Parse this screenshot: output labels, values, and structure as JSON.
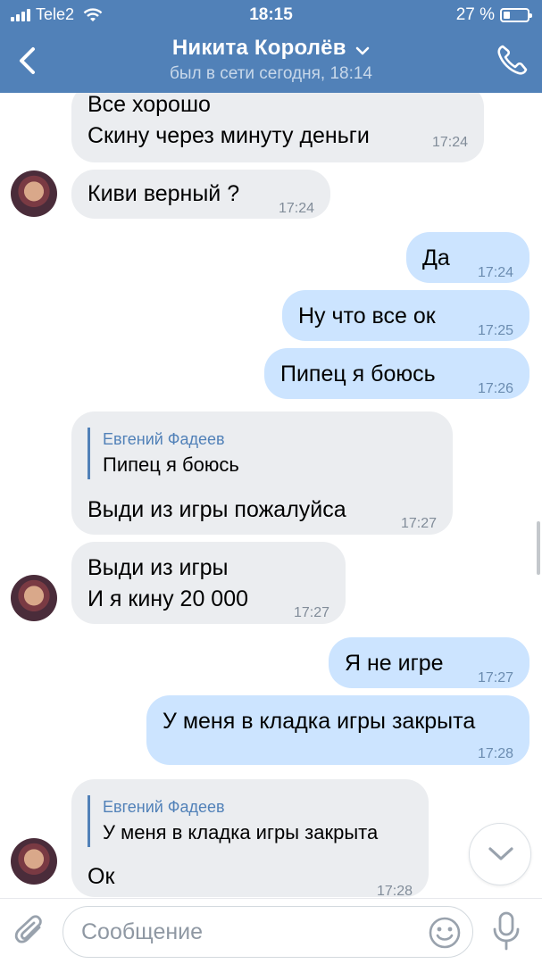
{
  "status_bar": {
    "carrier": "Tele2",
    "time": "18:15",
    "battery_percent": "27 %",
    "battery_level": 0.27
  },
  "header": {
    "contact_name": "Никита Королёв",
    "last_seen": "был в сети сегодня, 18:14"
  },
  "messages": [
    {
      "direction": "in",
      "lines": [
        "Все хорошо",
        "Скину через минуту деньги"
      ],
      "time": "17:24"
    },
    {
      "direction": "in",
      "lines": [
        "Киви верный ?"
      ],
      "time": "17:24"
    },
    {
      "direction": "out",
      "lines": [
        "Да"
      ],
      "time": "17:24"
    },
    {
      "direction": "out",
      "lines": [
        "Ну что все ок"
      ],
      "time": "17:25"
    },
    {
      "direction": "out",
      "lines": [
        "Пипец я боюсь"
      ],
      "time": "17:26"
    },
    {
      "direction": "in",
      "quote": {
        "author": "Евгений Фадеев",
        "text": "Пипец я боюсь"
      },
      "lines": [
        "Выди из игры пожалуйса"
      ],
      "time": "17:27"
    },
    {
      "direction": "in",
      "lines": [
        "Выди из игры",
        "И я кину 20 000"
      ],
      "time": "17:27"
    },
    {
      "direction": "out",
      "lines": [
        "Я не игре"
      ],
      "time": "17:27"
    },
    {
      "direction": "out",
      "lines": [
        "У меня в кладка игры закрыта"
      ],
      "time": "17:28"
    },
    {
      "direction": "in",
      "quote": {
        "author": "Евгений Фадеев",
        "text": "У меня в кладка игры закрыта"
      },
      "lines": [
        "Ок"
      ],
      "time": "17:28"
    }
  ],
  "composer": {
    "placeholder": "Сообщение"
  },
  "icons": {
    "back": "chevron-left-icon",
    "call": "phone-icon",
    "attach": "paperclip-icon",
    "emoji": "smiley-icon",
    "mic": "microphone-icon",
    "scroll_down": "chevron-down-icon"
  },
  "colors": {
    "header": "#5181b8",
    "incoming_bubble": "#ebedf0",
    "outgoing_bubble": "#cce4ff",
    "quote_accent": "#5181b8"
  }
}
